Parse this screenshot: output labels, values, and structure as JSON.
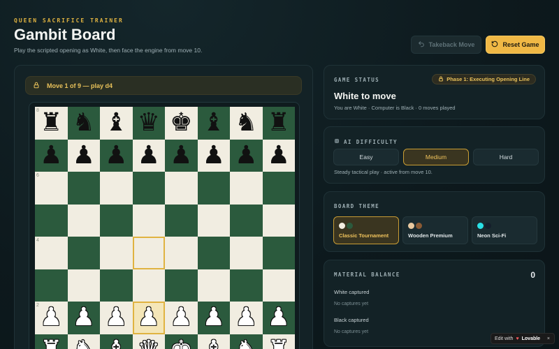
{
  "header": {
    "eyebrow": "QUEEN SACRIFICE TRAINER",
    "title": "Gambit Board",
    "subtitle": "Play the scripted opening as White, then face the engine from move 10."
  },
  "toolbar": {
    "takeback_label": "Takeback Move",
    "reset_label": "Reset Game"
  },
  "board": {
    "move_banner": "Move 1 of 9 — play d4",
    "rank_labels": {
      "8": "8",
      "6": "6",
      "4": "4",
      "2": "2"
    },
    "highlighted_squares": [
      "d4",
      "d2"
    ],
    "ranks": [
      [
        "br",
        "bn",
        "bb",
        "bq",
        "bk",
        "bb",
        "bn",
        "br"
      ],
      [
        "bp",
        "bp",
        "bp",
        "bp",
        "bp",
        "bp",
        "bp",
        "bp"
      ],
      [
        "",
        "",
        "",
        "",
        "",
        "",
        "",
        ""
      ],
      [
        "",
        "",
        "",
        "",
        "",
        "",
        "",
        ""
      ],
      [
        "",
        "",
        "",
        "",
        "",
        "",
        "",
        ""
      ],
      [
        "",
        "",
        "",
        "",
        "",
        "",
        "",
        ""
      ],
      [
        "wp",
        "wp",
        "wp",
        "wp",
        "wp",
        "wp",
        "wp",
        "wp"
      ],
      [
        "wr",
        "wn",
        "wb",
        "wq",
        "wk",
        "wb",
        "wn",
        "wr"
      ]
    ]
  },
  "status": {
    "heading": "GAME STATUS",
    "phase": "Phase 1: Executing Opening Line",
    "main": "White to move",
    "sub": "You are White · Computer is Black · 0 moves played"
  },
  "difficulty": {
    "heading": "AI DIFFICULTY",
    "options": [
      "Easy",
      "Medium",
      "Hard"
    ],
    "selected": "Medium",
    "note": "Steady tactical play · active from move 10."
  },
  "theme": {
    "heading": "BOARD THEME",
    "options": [
      {
        "label": "Classic Tournament",
        "colors": [
          "#f1ede1",
          "#2b5a3d"
        ]
      },
      {
        "label": "Wooden Premium",
        "colors": [
          "#e9c9a0",
          "#8a5a34"
        ]
      },
      {
        "label": "Neon Sci-Fi",
        "colors": [
          "#29e0e6",
          "#151e2b"
        ]
      }
    ],
    "selected": "Classic Tournament"
  },
  "material": {
    "heading": "MATERIAL BALANCE",
    "value": "0",
    "white_label": "White captured",
    "white_empty": "No captures yet",
    "black_label": "Black captured",
    "black_empty": "No captures yet"
  },
  "badge": {
    "prefix": "Edit with",
    "brand": "Lovable",
    "close": "×"
  },
  "colors": {
    "accent": "#e0b341",
    "board_light": "#f1ede1",
    "board_dark": "#2b5a3d",
    "panel": "#132226",
    "background": "#0e1b1f"
  }
}
